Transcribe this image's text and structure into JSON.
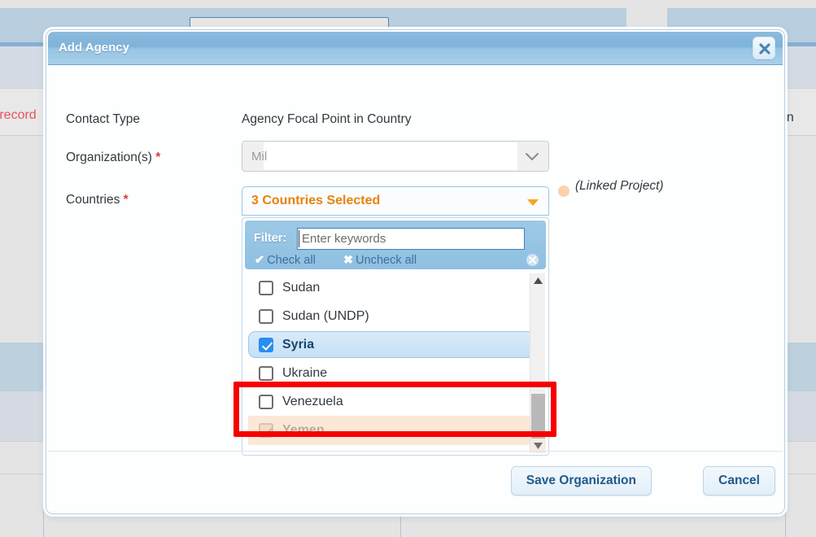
{
  "background": {
    "text_left_cut": "o record",
    "text_right_cut": "on"
  },
  "modal": {
    "title": "Add Agency",
    "close_icon": "close-x-icon",
    "fields": {
      "contact_type": {
        "label": "Contact Type",
        "value": "Agency Focal Point in Country"
      },
      "organization": {
        "label": "Organization(s)",
        "required_marker": "*",
        "value": "Mil",
        "chevron_icon": "chevron-down-icon"
      },
      "countries": {
        "label": "Countries",
        "required_marker": "*",
        "summary": "3 Countries Selected",
        "caret_icon": "caret-down-icon"
      }
    },
    "legend": {
      "dot_color": "#fbd2ac",
      "text": "(Linked Project)"
    },
    "dropdown": {
      "filter_label": "Filter:",
      "filter_value": "",
      "filter_placeholder": "Enter keywords",
      "check_all": "Check all",
      "check_all_icon": "check-icon",
      "uncheck_all": "Uncheck all",
      "uncheck_all_icon": "cross-icon",
      "close_icon": "close-circle-icon",
      "scroll_up_icon": "triangle-up-icon",
      "scroll_down_icon": "triangle-down-icon",
      "options": [
        {
          "label": "Sudan",
          "checked": false,
          "state": "normal"
        },
        {
          "label": "Sudan (UNDP)",
          "checked": false,
          "state": "normal"
        },
        {
          "label": "Syria",
          "checked": true,
          "state": "selected"
        },
        {
          "label": "Ukraine",
          "checked": false,
          "state": "normal"
        },
        {
          "label": "Venezuela",
          "checked": false,
          "state": "normal"
        },
        {
          "label": "Yemen",
          "checked": true,
          "state": "linked-disabled"
        }
      ]
    },
    "footer": {
      "save_label": "Save Organization",
      "cancel_label": "Cancel"
    }
  },
  "annotation": {
    "color": "#f60000",
    "target": "Yemen"
  }
}
